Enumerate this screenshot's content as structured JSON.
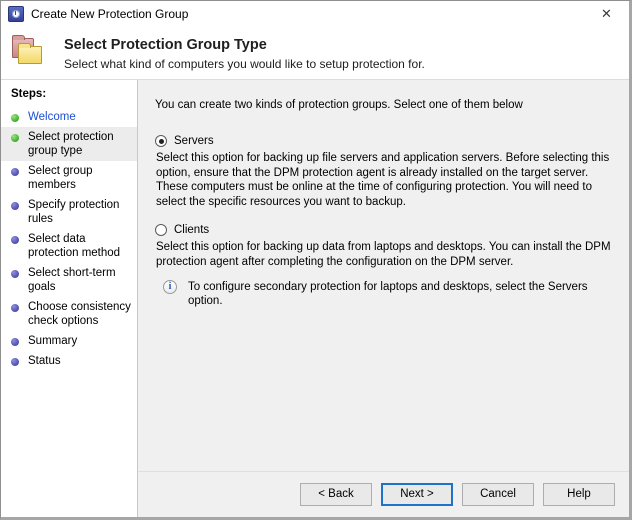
{
  "window": {
    "title": "Create New Protection Group",
    "icon": "dpm-clock-icon",
    "close_label": "✕"
  },
  "header": {
    "icon": "folders-icon",
    "title": "Select Protection Group Type",
    "subtitle": "Select what kind of computers you would like to setup protection for."
  },
  "sidebar": {
    "label": "Steps:",
    "items": [
      {
        "label": "Welcome",
        "state": "done",
        "style": "link"
      },
      {
        "label": "Select protection group type",
        "state": "done",
        "style": "current"
      },
      {
        "label": "Select group members",
        "state": "pending",
        "style": "normal"
      },
      {
        "label": "Specify protection rules",
        "state": "pending",
        "style": "normal"
      },
      {
        "label": "Select data protection method",
        "state": "pending",
        "style": "normal"
      },
      {
        "label": "Select short-term goals",
        "state": "pending",
        "style": "normal"
      },
      {
        "label": "Choose consistency check options",
        "state": "pending",
        "style": "normal"
      },
      {
        "label": "Summary",
        "state": "pending",
        "style": "normal"
      },
      {
        "label": "Status",
        "state": "pending",
        "style": "normal"
      }
    ]
  },
  "main": {
    "intro": "You can create two kinds of protection groups. Select one of them below",
    "options": [
      {
        "id": "servers",
        "label": "Servers",
        "selected": true,
        "description": "Select this option for backing up file servers and application servers. Before selecting this option, ensure that the DPM protection agent is already installed on the target server. These computers must be online at the time of configuring protection. You will need to select the specific resources you want to backup."
      },
      {
        "id": "clients",
        "label": "Clients",
        "selected": false,
        "description": "Select this option for backing up data from laptops and desktops. You can install the DPM protection agent after completing the configuration on the DPM server."
      }
    ],
    "note": {
      "icon": "info-icon",
      "text": "To configure secondary protection for laptops and desktops, select the Servers option."
    }
  },
  "footer": {
    "buttons": [
      {
        "id": "back",
        "label": "< Back",
        "default": false,
        "enabled": true
      },
      {
        "id": "next",
        "label": "Next >",
        "default": true,
        "enabled": true
      },
      {
        "id": "cancel",
        "label": "Cancel",
        "default": false,
        "enabled": true
      },
      {
        "id": "help",
        "label": "Help",
        "default": false,
        "enabled": true
      }
    ]
  },
  "colors": {
    "window_bg": "#f0f0f0",
    "sidebar_bg": "#ffffff",
    "current_step_bg": "#ececec",
    "link": "#1c4fd8",
    "done_bullet": "#4fbb3b",
    "pending_bullet": "#5b5bb8",
    "default_button_border": "#1f72c8",
    "info_blue": "#3a63b8"
  }
}
